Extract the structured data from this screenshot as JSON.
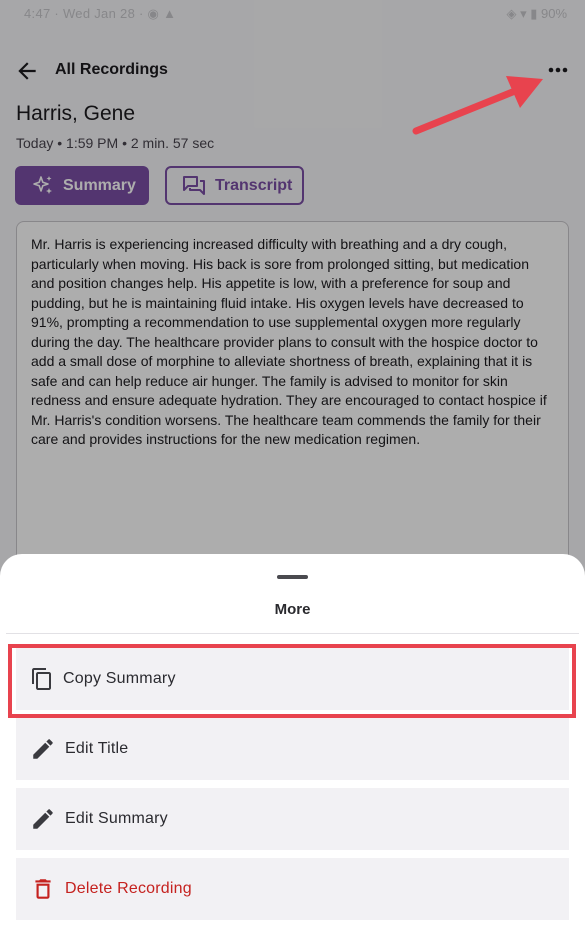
{
  "status_bar": {
    "left_text": "4:47 · Wed Jan 28 · ◉ ▲",
    "right_text": "◈ ▾ ▮ 90%"
  },
  "header": {
    "back_icon": "arrow-left-icon",
    "title": "All Recordings",
    "menu_icon": "more-horizontal-icon"
  },
  "recording": {
    "patient_name": "Harris, Gene",
    "meta": "Today • 1:59 PM • 2 min. 57 sec"
  },
  "view_toggle": {
    "summary_label": "Summary",
    "summary_icon": "sparkles-icon",
    "transcript_label": "Transcript",
    "transcript_icon": "chat-bubbles-icon",
    "active": "summary"
  },
  "summary_text": "Mr. Harris is experiencing increased difficulty with breathing and a dry cough, particularly when moving. His back is sore from prolonged sitting, but medication and position changes help. His appetite is low, with a preference for soup and pudding, but he is maintaining fluid intake. His oxygen levels have decreased to 91%, prompting a recommendation to use supplemental oxygen more regularly during the day. The healthcare provider plans to consult with the hospice doctor to add a small dose of morphine to alleviate shortness of breath, explaining that it is safe and can help reduce air hunger. The family is advised to monitor for skin redness and ensure adequate hydration. They are encouraged to contact hospice if Mr. Harris's condition worsens. The healthcare team commends the family for their care and provides instructions for the new medication regimen.",
  "sheet": {
    "title": "More",
    "items": [
      {
        "label": "Copy Summary",
        "icon": "copy-icon"
      },
      {
        "label": "Edit Title",
        "icon": "pencil-icon"
      },
      {
        "label": "Edit Summary",
        "icon": "pencil-icon"
      },
      {
        "label": "Delete Recording",
        "icon": "trash-icon"
      }
    ]
  },
  "colors": {
    "accent": "#7b4fa6",
    "danger": "#c5221f",
    "annotation": "#e8434e"
  }
}
